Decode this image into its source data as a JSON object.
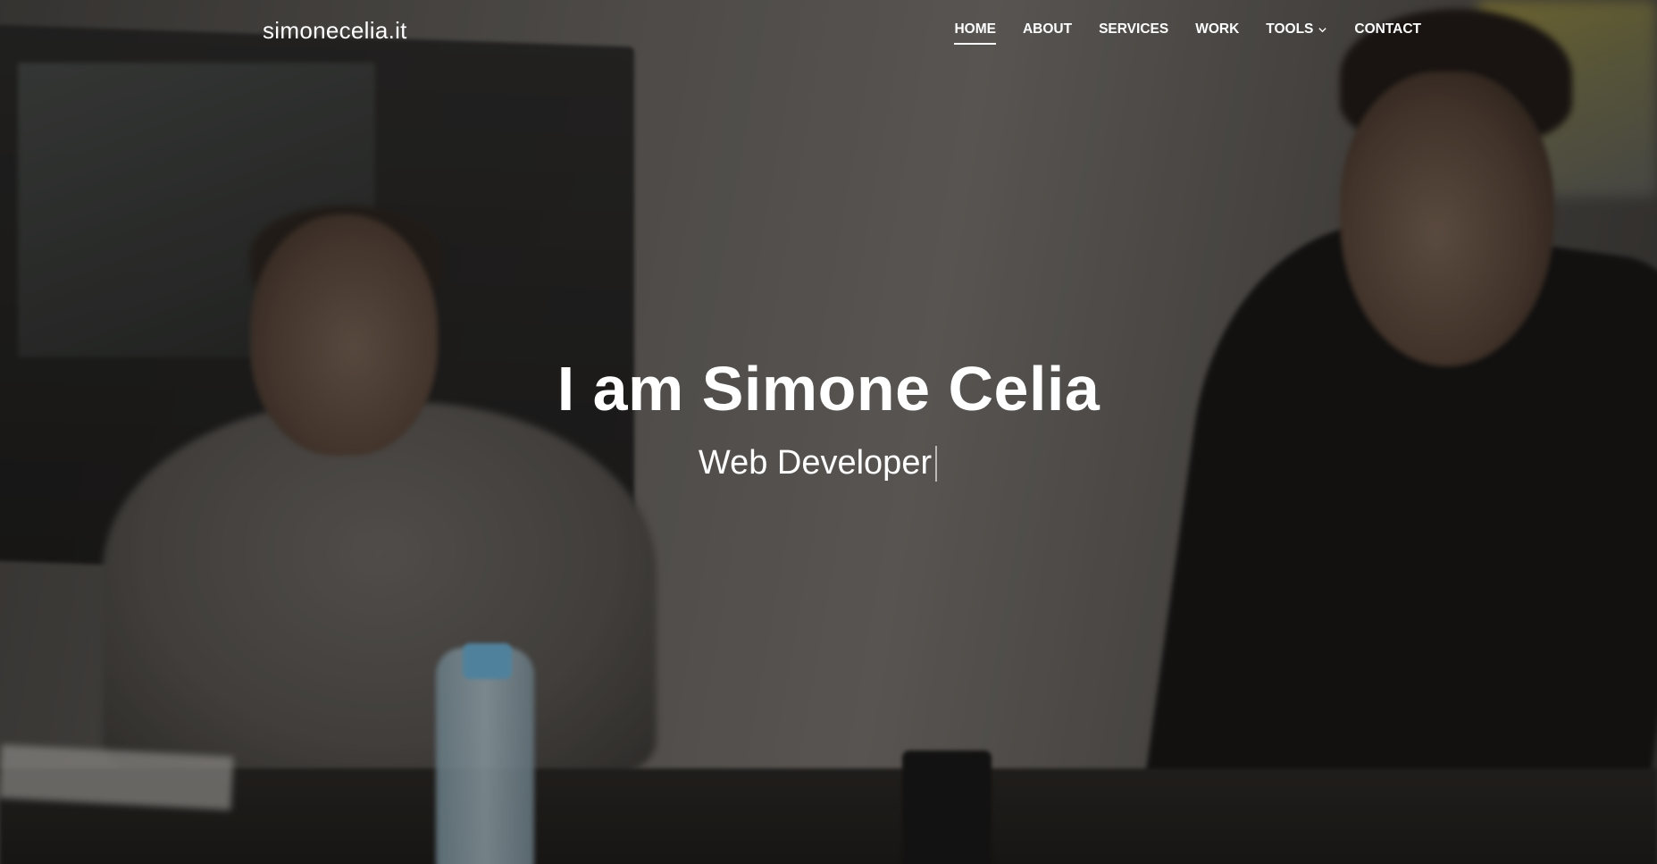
{
  "brand": "simonecelia.it",
  "nav": {
    "items": [
      {
        "label": "HOME",
        "active": true
      },
      {
        "label": "ABOUT",
        "active": false
      },
      {
        "label": "SERVICES",
        "active": false
      },
      {
        "label": "WORK",
        "active": false
      },
      {
        "label": "TOOLS",
        "active": false,
        "dropdown": true
      },
      {
        "label": "CONTACT",
        "active": false
      }
    ]
  },
  "hero": {
    "title": "I am Simone Celia",
    "subtitle": "Web Developer"
  },
  "icons": {
    "tools_dropdown": "chevron-down-icon"
  },
  "colors": {
    "text": "#ffffff",
    "overlay": "rgba(0,0,0,0.28)"
  }
}
